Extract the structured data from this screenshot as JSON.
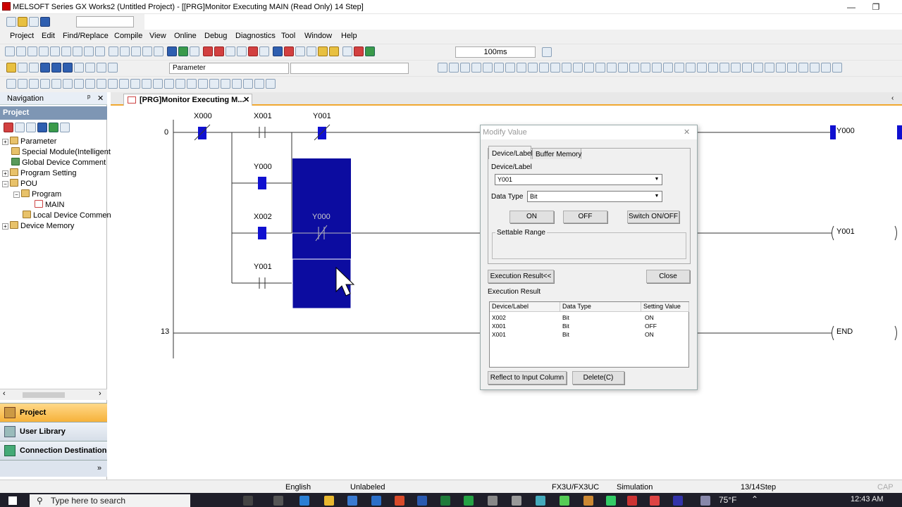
{
  "window": {
    "title": "MELSOFT Series GX Works2 (Untitled Project) - [[PRG]Monitor Executing MAIN (Read Only) 14 Step]",
    "minimize": "—",
    "restore": "❐"
  },
  "menu": [
    "Project",
    "Edit",
    "Find/Replace",
    "Compile",
    "View",
    "Online",
    "Debug",
    "Diagnostics",
    "Tool",
    "Window",
    "Help"
  ],
  "toolbar": {
    "scan_time": "100ms",
    "parameter_combo": "Parameter"
  },
  "navigation": {
    "title": "Navigation",
    "pin": "ᵖ",
    "close": "✕",
    "section": "Project",
    "tree": [
      {
        "label": "Parameter",
        "level": 0,
        "expander": "+"
      },
      {
        "label": "Special Module(Intelligent",
        "level": 0,
        "expander": ""
      },
      {
        "label": "Global Device Comment",
        "level": 0,
        "expander": ""
      },
      {
        "label": "Program Setting",
        "level": 0,
        "expander": "+"
      },
      {
        "label": "POU",
        "level": 0,
        "expander": "−"
      },
      {
        "label": "Program",
        "level": 1,
        "expander": "−"
      },
      {
        "label": "MAIN",
        "level": 2,
        "expander": ""
      },
      {
        "label": "Local Device Commen",
        "level": 1,
        "expander": ""
      },
      {
        "label": "Device Memory",
        "level": 0,
        "expander": "+"
      }
    ],
    "scroll_left": "‹",
    "scroll_right": "›",
    "buttons": [
      "Project",
      "User Library",
      "Connection Destination"
    ],
    "more": "»"
  },
  "editor": {
    "tab": "[PRG]Monitor Executing M...",
    "tab_close": "✕",
    "ladder": {
      "step_labels": [
        "0",
        "13"
      ],
      "contacts": [
        "X000",
        "X001",
        "Y001",
        "Y000",
        "X002",
        "Y000",
        "Y001"
      ],
      "coils": [
        "Y000",
        "Y001",
        "END"
      ]
    }
  },
  "dialog": {
    "title": "Modify Value",
    "close": "✕",
    "tabs": [
      "Device/Label",
      "Buffer Memory"
    ],
    "device_label_caption": "Device/Label",
    "device_value": "Y001",
    "data_type_caption": "Data Type",
    "data_type_value": "Bit",
    "btn_on": "ON",
    "btn_off": "OFF",
    "btn_switch": "Switch ON/OFF",
    "settable_range": "Settable Range",
    "btn_exec_result": "Execution Result<<",
    "btn_close": "Close",
    "execution_result_caption": "Execution Result",
    "table": {
      "headers": [
        "Device/Label",
        "Data Type",
        "Setting Value"
      ],
      "rows": [
        [
          "X002",
          "Bit",
          "ON"
        ],
        [
          "X001",
          "Bit",
          "OFF"
        ],
        [
          "X001",
          "Bit",
          "ON"
        ]
      ]
    },
    "btn_reflect": "Reflect to Input Column",
    "btn_delete": "Delete(C)"
  },
  "status": {
    "language": "English",
    "label": "Unlabeled",
    "cpu": "FX3U/FX3UC",
    "mode": "Simulation",
    "steps": "13/14Step",
    "cap": "CAP"
  },
  "taskbar": {
    "search_placeholder": "Type here to search",
    "weather": "75°F",
    "time": "12:43 AM"
  }
}
